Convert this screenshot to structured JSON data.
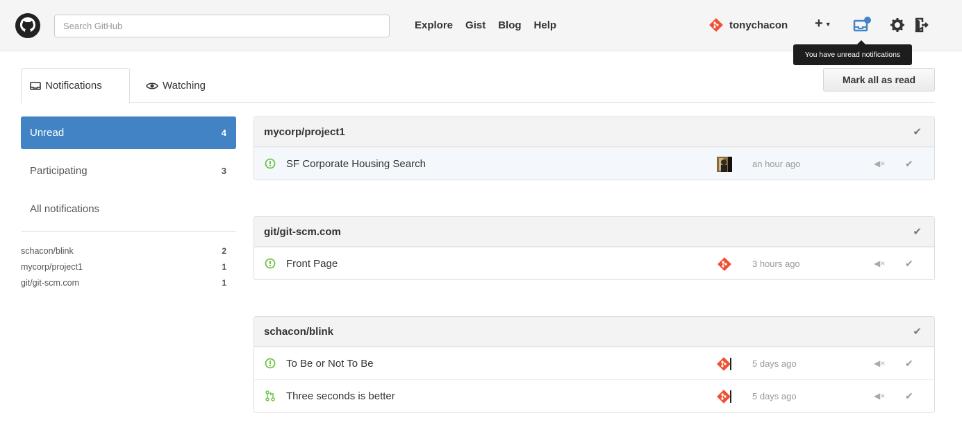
{
  "header": {
    "search_placeholder": "Search GitHub",
    "nav": [
      "Explore",
      "Gist",
      "Blog",
      "Help"
    ],
    "username": "tonychacon",
    "plus_label": "+",
    "tooltip": "You have unread notifications",
    "colors": {
      "accent": "#4183c4",
      "git_orange": "#f05033",
      "green": "#6cc644"
    }
  },
  "tabs": {
    "notifications": "Notifications",
    "watching": "Watching"
  },
  "mark_all": "Mark all as read",
  "sidebar": {
    "filters": [
      {
        "label": "Unread",
        "count": "4"
      },
      {
        "label": "Participating",
        "count": "3"
      },
      {
        "label": "All notifications",
        "count": ""
      }
    ],
    "repos": [
      {
        "name": "schacon/blink",
        "count": "2"
      },
      {
        "name": "mycorp/project1",
        "count": "1"
      },
      {
        "name": "git/git-scm.com",
        "count": "1"
      }
    ]
  },
  "groups": [
    {
      "repo": "mycorp/project1",
      "items": [
        {
          "title": "SF Corporate Housing Search",
          "time": "an hour ago",
          "icon": "issue-open-icon",
          "avatar": "photo-avatar"
        }
      ]
    },
    {
      "repo": "git/git-scm.com",
      "items": [
        {
          "title": "Front Page",
          "time": "3 hours ago",
          "icon": "issue-open-icon",
          "avatar": "git-logo-avatar"
        }
      ]
    },
    {
      "repo": "schacon/blink",
      "items": [
        {
          "title": "To Be or Not To Be",
          "time": "5 days ago",
          "icon": "issue-open-icon",
          "avatar": "git-logo-avatar"
        },
        {
          "title": "Three seconds is better",
          "time": "5 days ago",
          "icon": "pull-request-icon",
          "avatar": "git-logo-avatar"
        }
      ]
    }
  ]
}
